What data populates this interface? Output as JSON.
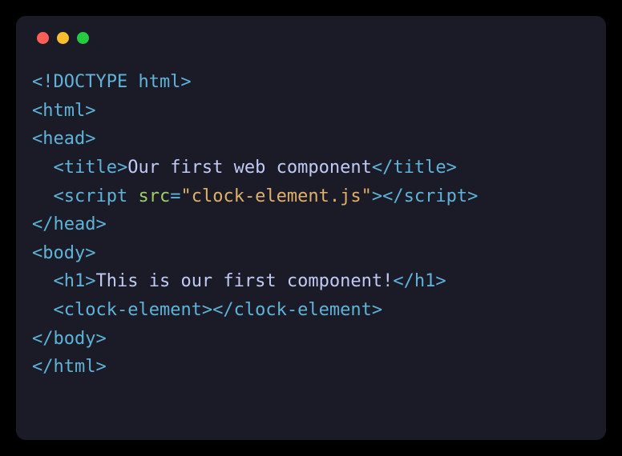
{
  "code": {
    "line1": {
      "doctype": "<!DOCTYPE html>"
    },
    "line2": {
      "open": "<html>"
    },
    "line3": {
      "open": "<head>"
    },
    "line4": {
      "indent": "  ",
      "openTag": "<title>",
      "content": "Our first web component",
      "closeTag": "</title>"
    },
    "line5": {
      "indent": "  ",
      "tagOpen": "<script ",
      "attrName": "src",
      "eq": "=",
      "attrVal": "\"clock-element.js\"",
      "tagClose": ">",
      "closeTag": "</script>"
    },
    "line6": {
      "close": "</head>"
    },
    "line7": {
      "open": "<body>"
    },
    "line8": {
      "indent": "  ",
      "openTag": "<h1>",
      "content": "This is our first component!",
      "closeTag": "</h1>"
    },
    "line9": {
      "indent": "  ",
      "openTag": "<clock-element>",
      "closeTag": "</clock-element>"
    },
    "line10": {
      "close": "</body>"
    },
    "line11": {
      "close": "</html>"
    }
  }
}
